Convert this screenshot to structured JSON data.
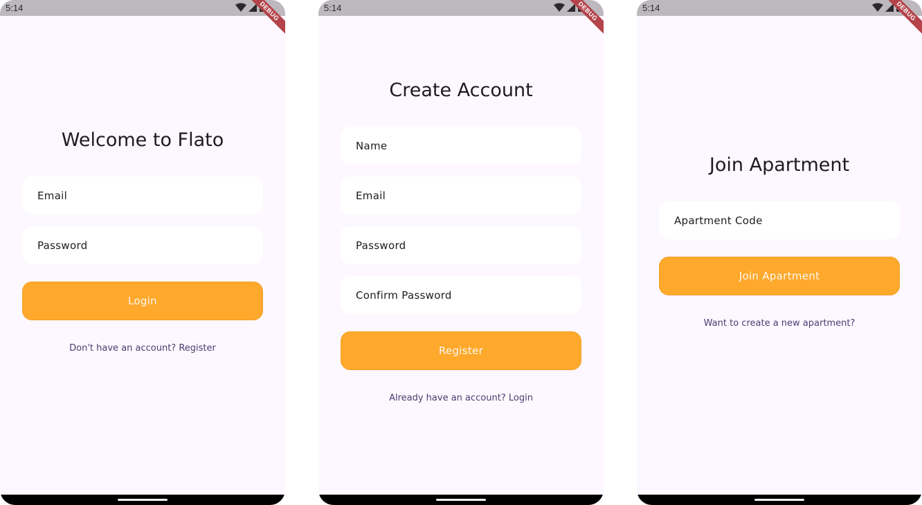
{
  "status_bar": {
    "time": "5:14",
    "debug_label": "DEBUG"
  },
  "colors": {
    "accent": "#fea82c",
    "background": "#fdf7ff",
    "link": "#4a3d70"
  },
  "login": {
    "title": "Welcome to Flato",
    "email_placeholder": "Email",
    "password_placeholder": "Password",
    "login_button": "Login",
    "register_link": "Don't have an account? Register"
  },
  "register": {
    "title": "Create Account",
    "name_placeholder": "Name",
    "email_placeholder": "Email",
    "password_placeholder": "Password",
    "confirm_placeholder": "Confirm Password",
    "register_button": "Register",
    "login_link": "Already have an account? Login"
  },
  "join": {
    "title": "Join Apartment",
    "code_placeholder": "Apartment Code",
    "join_button": "Join Apartment",
    "create_link": "Want to create a new apartment?"
  }
}
